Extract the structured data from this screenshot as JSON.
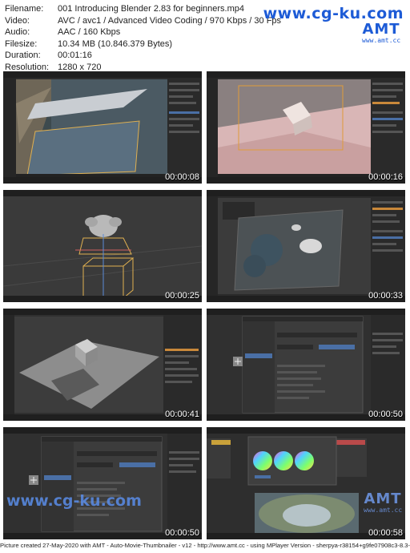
{
  "info": {
    "filename_label": "Filename:",
    "filename": "001 Introducing Blender 2.83 for beginners.mp4",
    "video_label": "Video:",
    "video": "AVC / avc1 / Advanced Video Coding / 970 Kbps / 30 Fps",
    "audio_label": "Audio:",
    "audio": "AAC / 160 Kbps",
    "filesize_label": "Filesize:",
    "filesize": "10.34 MB (10.846.379 Bytes)",
    "duration_label": "Duration:",
    "duration": "00:01:16",
    "resolution_label": "Resolution:",
    "resolution": "1280 x 720"
  },
  "watermark": {
    "site": "www.cg-ku.com",
    "amt_logo": "AMT",
    "amt_url": "www.amt.cc"
  },
  "thumbnails": [
    {
      "timestamp": "00:00:08",
      "scene": "ocean-planes"
    },
    {
      "timestamp": "00:00:16",
      "scene": "pink-cube"
    },
    {
      "timestamp": "00:00:25",
      "scene": "monkey-lattice"
    },
    {
      "timestamp": "00:00:33",
      "scene": "dark-view-objects"
    },
    {
      "timestamp": "00:00:41",
      "scene": "grey-cube"
    },
    {
      "timestamp": "00:00:50",
      "scene": "preferences-dialog"
    },
    {
      "timestamp": "00:00:50",
      "scene": "preferences-dialog-wide"
    },
    {
      "timestamp": "00:00:58",
      "scene": "color-wheels"
    }
  ],
  "footer": "Picture created 27-May-2020 with AMT - Auto-Movie-Thumbnailer - v12 - http://www.amt.cc - using MPlayer Version - sherpya-r38154+g9fe07908c3-8.3-win32"
}
